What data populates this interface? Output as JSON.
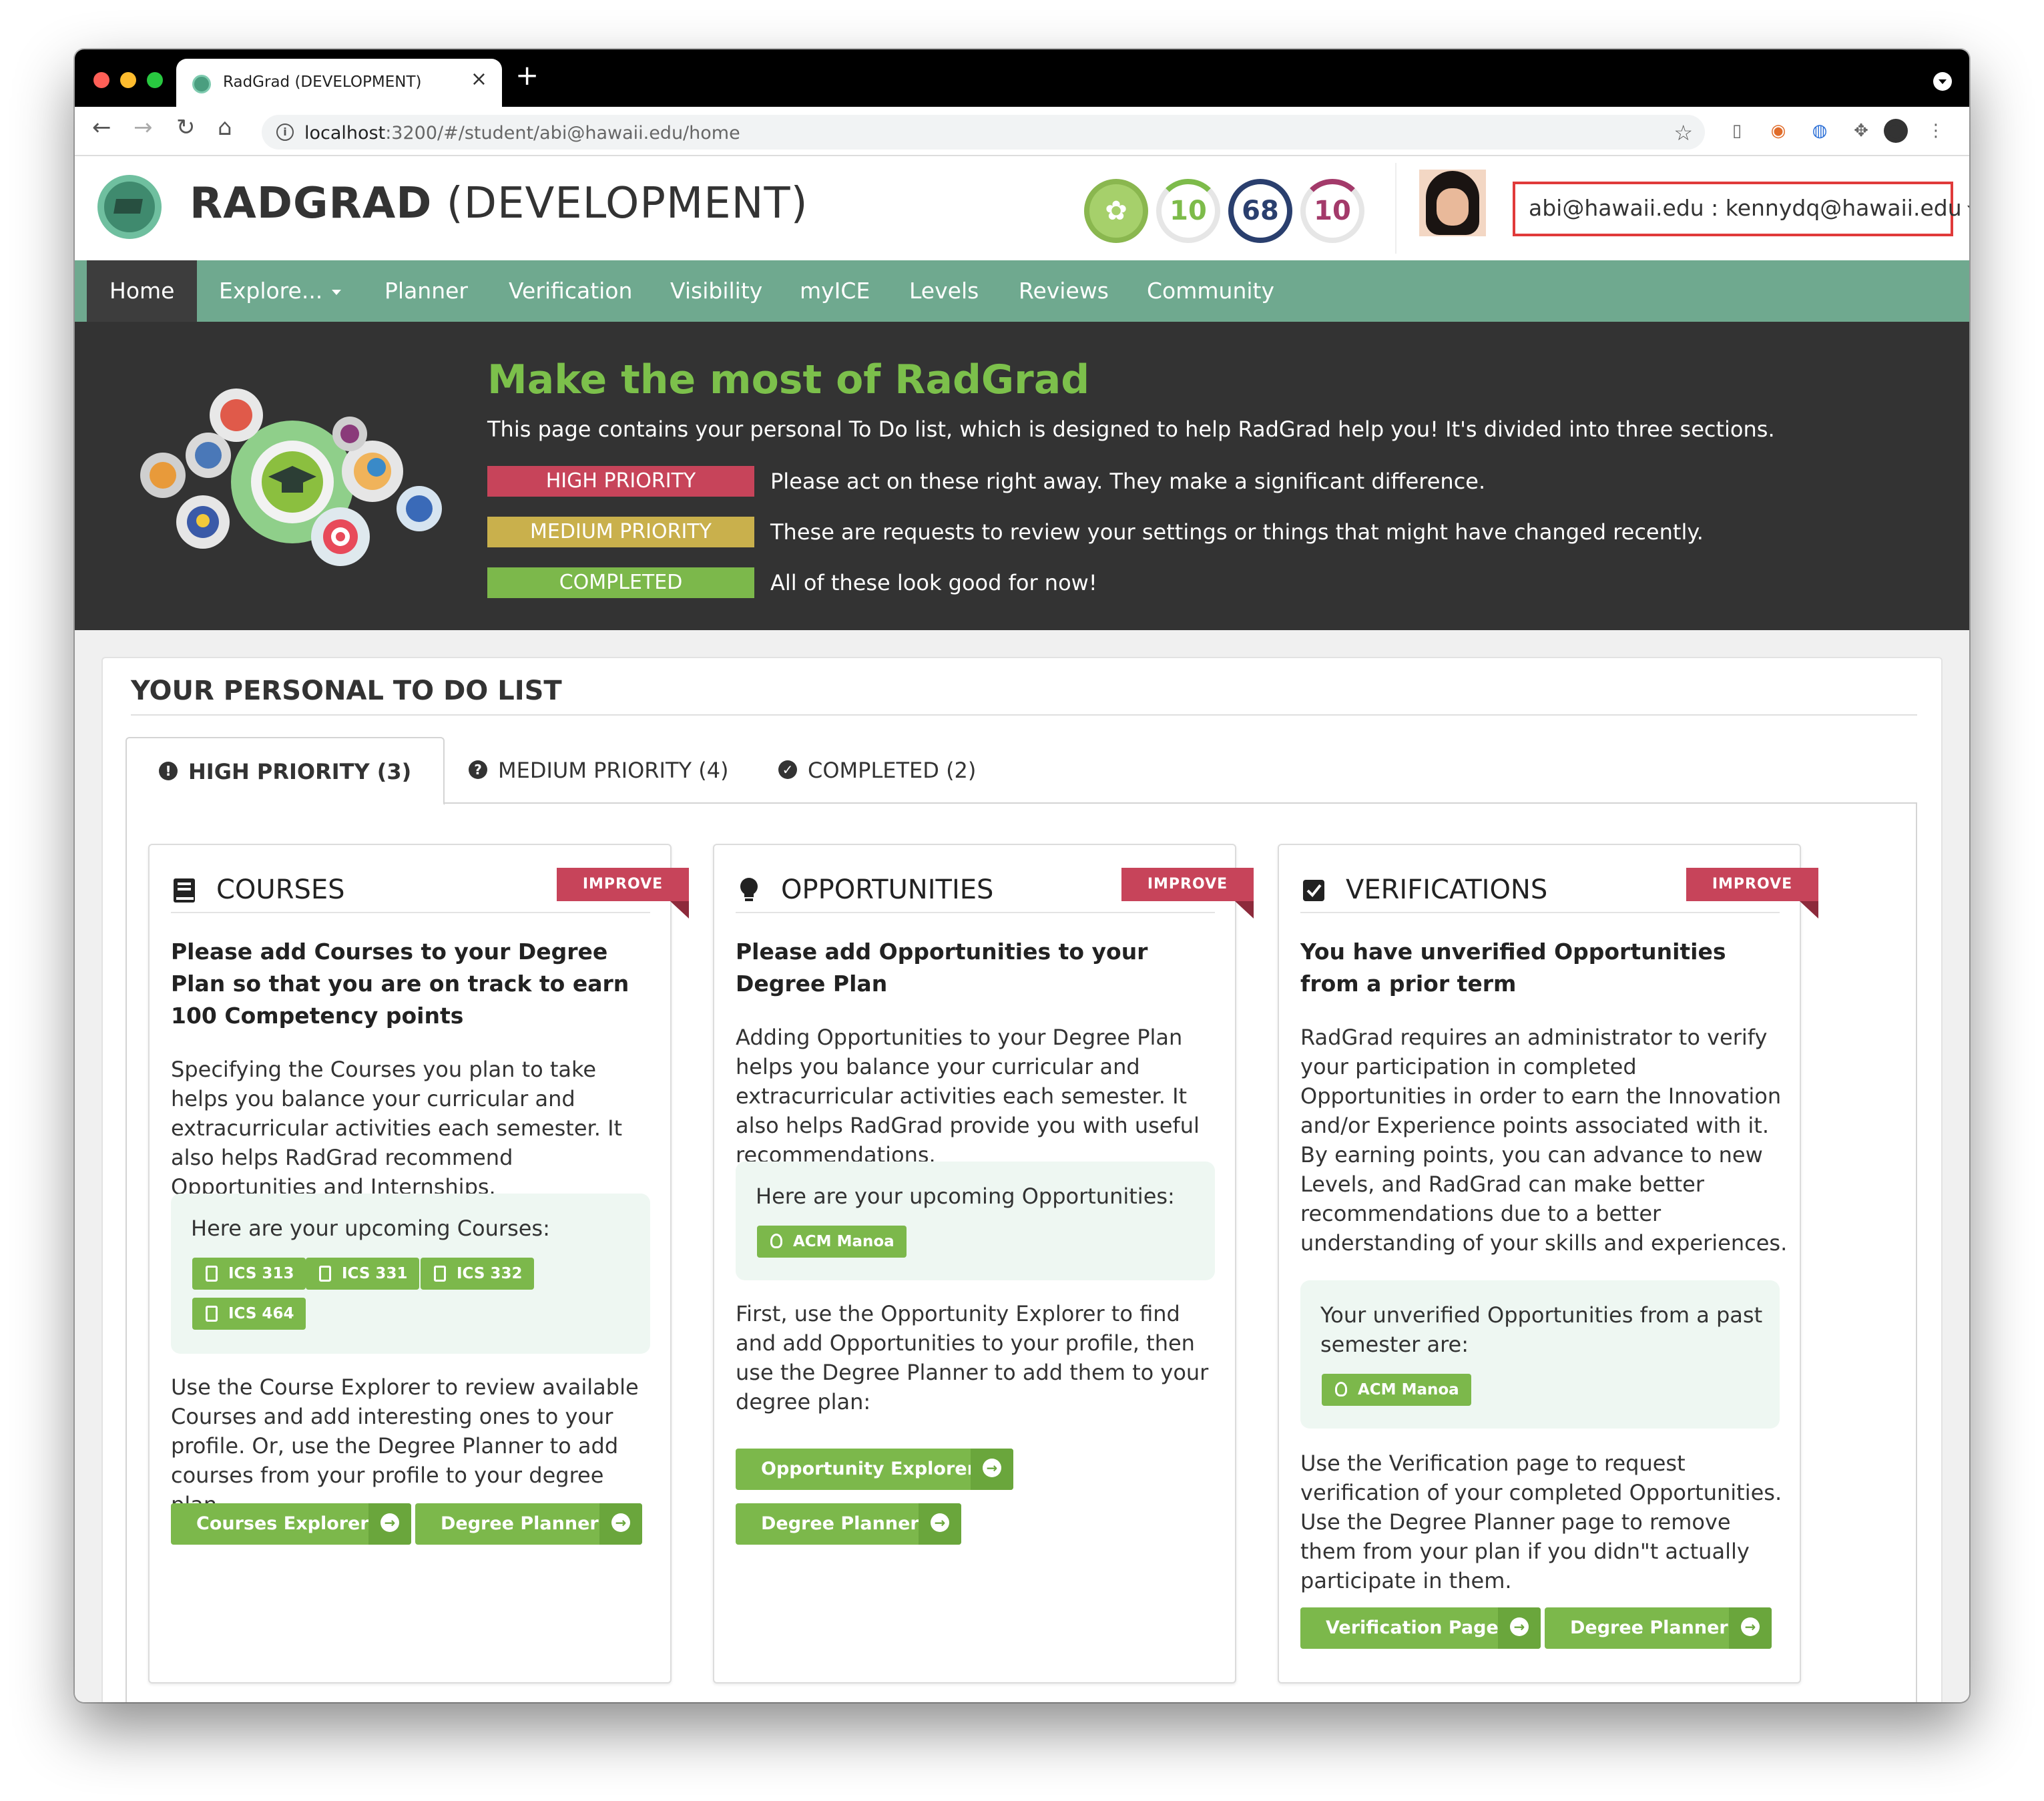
{
  "browser": {
    "tab_title": "RadGrad (DEVELOPMENT)",
    "url_host": "localhost",
    "url_path": ":3200/#/student/abi@hawaii.edu/home"
  },
  "header": {
    "brand_bold": "RADGRAD",
    "brand_rest": " (DEVELOPMENT)",
    "ice": {
      "innovation": "10",
      "competency": "68",
      "experience": "10"
    },
    "user": "abi@hawaii.edu : kennydq@hawaii.edu"
  },
  "nav": {
    "items": [
      "Home",
      "Explore...",
      "Planner",
      "Verification",
      "Visibility",
      "myICE",
      "Levels",
      "Reviews",
      "Community"
    ]
  },
  "hero": {
    "title": "Make the most of RadGrad",
    "intro": "This page contains your personal To Do list, which is designed to help RadGrad help you! It's divided into three sections.",
    "rows": [
      {
        "label": "HIGH PRIORITY",
        "desc": "Please act on these right away. They make a significant difference.",
        "color": "#c7445a"
      },
      {
        "label": "MEDIUM PRIORITY",
        "desc": "These are requests to review your settings or things that might have changed recently.",
        "color": "#c9b04c"
      },
      {
        "label": "COMPLETED",
        "desc": "All of these look good for now!",
        "color": "#7cb84b"
      }
    ]
  },
  "todo": {
    "title": "YOUR PERSONAL TO DO LIST",
    "tabs": [
      "HIGH PRIORITY (3)",
      "MEDIUM PRIORITY (4)",
      "COMPLETED (2)"
    ]
  },
  "cards": {
    "courses": {
      "title": "COURSES",
      "ribbon": "IMPROVE",
      "heading": "Please add Courses to your Degree Plan so that you are on track to earn 100 Competency points",
      "p1": "Specifying the Courses you plan to take helps you balance your curricular and extracurricular activities each semester. It also helps RadGrad recommend Opportunities and Internships.",
      "well": "Here are your upcoming Courses:",
      "chips": [
        "ICS 313",
        "ICS 331",
        "ICS 332",
        "ICS 464"
      ],
      "p2": "Use the Course Explorer to review available Courses and add interesting ones to your profile. Or, use the Degree Planner to add courses from your profile to your degree plan.",
      "buttons": [
        "Courses Explorer",
        "Degree Planner"
      ]
    },
    "opportunities": {
      "title": "OPPORTUNITIES",
      "ribbon": "IMPROVE",
      "heading": "Please add Opportunities to your Degree Plan",
      "p1": "Adding Opportunities to your Degree Plan helps you balance your curricular and extracurricular activities each semester. It also helps RadGrad provide you with useful recommendations.",
      "well": "Here are your upcoming Opportunities:",
      "chips": [
        "ACM Manoa"
      ],
      "p2": "First, use the Opportunity Explorer to find and add Opportunities to your profile, then use the Degree Planner to add them to your degree plan:",
      "buttons": [
        "Opportunity Explorer",
        "Degree Planner"
      ]
    },
    "verifications": {
      "title": "VERIFICATIONS",
      "ribbon": "IMPROVE",
      "heading": "You have unverified Opportunities from a prior term",
      "p1": "RadGrad requires an administrator to verify your participation in completed Opportunities in order to earn the Innovation and/or Experience points associated with it. By earning points, you can advance to new Levels, and RadGrad can make better recommendations due to a better understanding of your skills and experiences.",
      "well": "Your unverified Opportunities from a past semester are:",
      "chips": [
        "ACM Manoa"
      ],
      "p2": "Use the Verification page to request verification of your completed Opportunities. Use the Degree Planner page to remove them from your plan if you didn\"t actually participate in them.",
      "buttons": [
        "Verification Page",
        "Degree Planner"
      ]
    }
  }
}
